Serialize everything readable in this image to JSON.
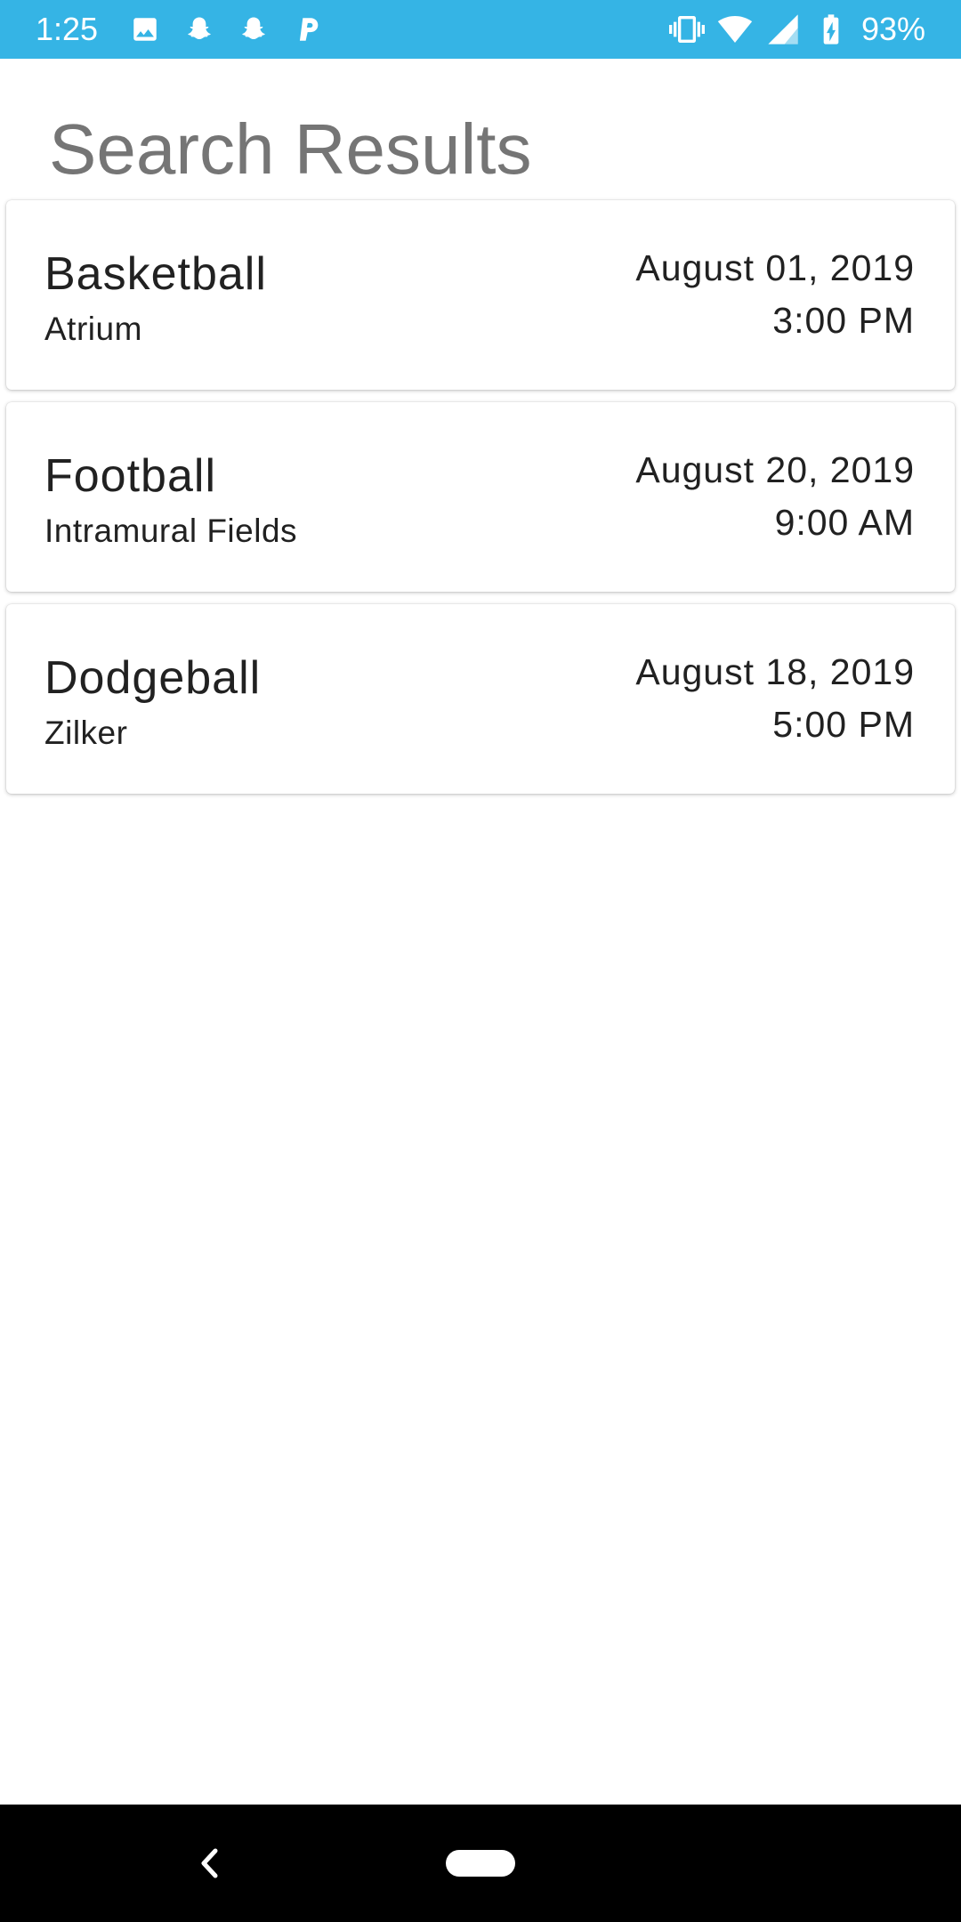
{
  "status_bar": {
    "time": "1:25",
    "battery_percent": "93%",
    "background_color": "#35b4e5",
    "left_icons": [
      "image-icon",
      "snapchat-icon",
      "snapchat-icon",
      "parking-icon"
    ],
    "right_icons": [
      "vibrate-icon",
      "wifi-icon",
      "cell-signal-icon",
      "battery-charging-icon"
    ]
  },
  "header": {
    "title": "Search Results"
  },
  "results": [
    {
      "title": "Basketball",
      "location": "Atrium",
      "date": "August 01, 2019",
      "time": "3:00 PM"
    },
    {
      "title": "Football",
      "location": "Intramural Fields",
      "date": "August 20, 2019",
      "time": "9:00 AM"
    },
    {
      "title": "Dodgeball",
      "location": "Zilker",
      "date": "August 18, 2019",
      "time": "5:00 PM"
    }
  ],
  "nav_bar": {
    "icons": [
      "back-icon",
      "home-pill-icon"
    ]
  }
}
